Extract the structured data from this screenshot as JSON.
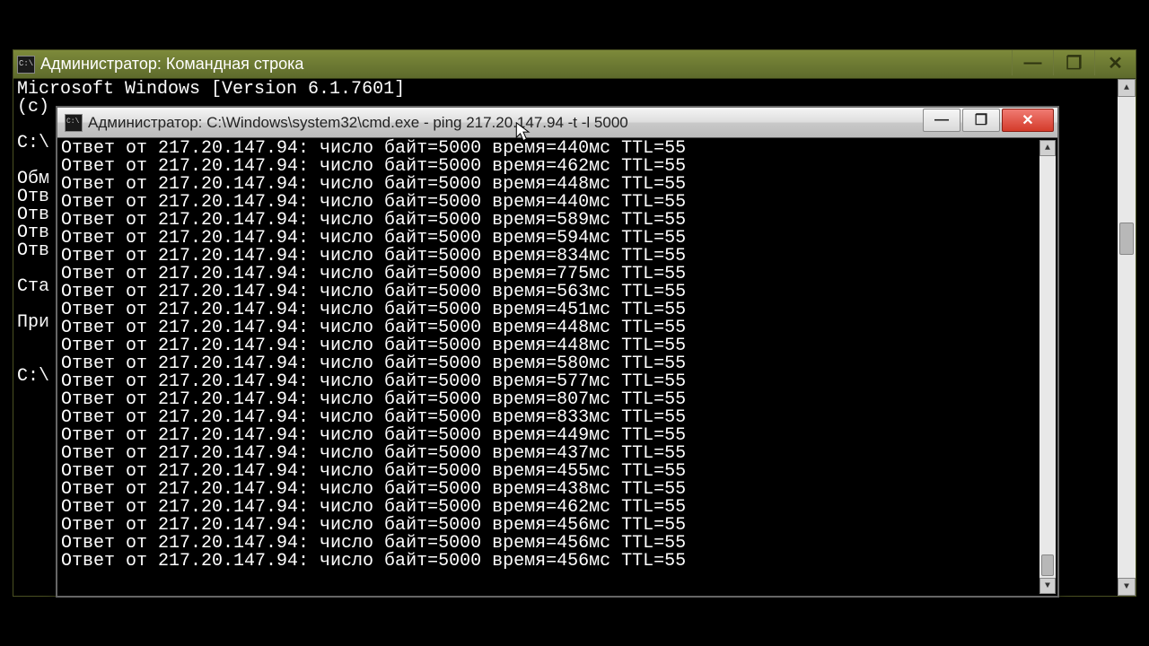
{
  "bg_window": {
    "title": "Администратор: Командная строка",
    "lines": [
      "Microsoft Windows [Version 6.1.7601]",
      "(c)",
      "",
      "C:\\",
      "",
      "Обм",
      "Отв",
      "Отв",
      "Отв",
      "Отв",
      "",
      "Ста",
      "",
      "При",
      "",
      "",
      "C:\\"
    ]
  },
  "fg_window": {
    "title": "Администратор: C:\\Windows\\system32\\cmd.exe - ping  217.20.147.94 -t -l 5000",
    "ip": "217.20.147.94",
    "bytes": "5000",
    "ttl": "55",
    "times": [
      "440",
      "462",
      "448",
      "440",
      "589",
      "594",
      "834",
      "775",
      "563",
      "451",
      "448",
      "448",
      "580",
      "577",
      "807",
      "833",
      "449",
      "437",
      "455",
      "438",
      "462",
      "456",
      "456",
      "456"
    ]
  },
  "icons": {
    "minimize": "—",
    "maximize": "❐",
    "close": "✕",
    "up": "▲",
    "down": "▼"
  }
}
